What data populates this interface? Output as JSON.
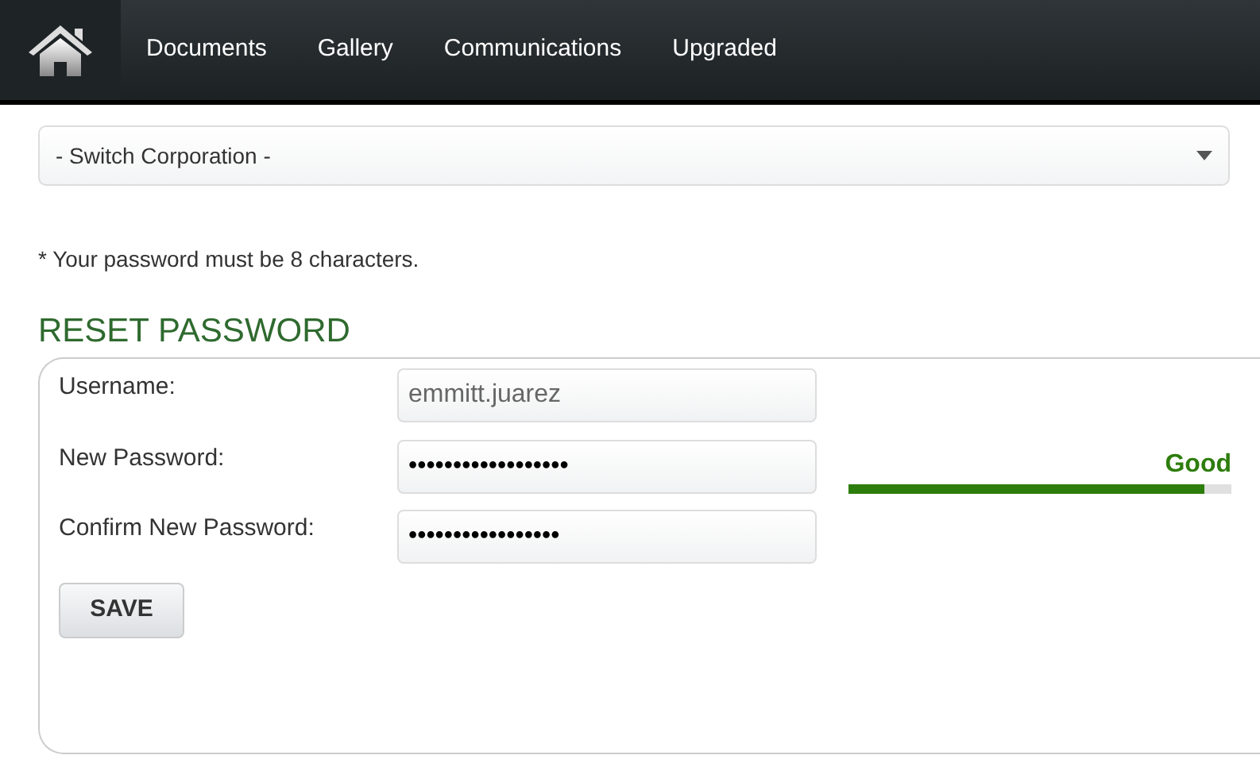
{
  "navbar": {
    "items": [
      {
        "label": "Documents"
      },
      {
        "label": "Gallery"
      },
      {
        "label": "Communications"
      },
      {
        "label": "Upgraded"
      }
    ]
  },
  "corporation_select": {
    "value": "- Switch Corporation -"
  },
  "note": "* Your password must be 8 characters.",
  "heading": "RESET PASSWORD",
  "form": {
    "fields": [
      {
        "label": "Username:",
        "value": "emmitt.juarez",
        "disabled": true
      },
      {
        "label": "New Password:",
        "value": "••••••••••••••••••",
        "disabled": false
      },
      {
        "label": "Confirm New Password:",
        "value": "•••••••••••••••••",
        "disabled": false
      }
    ],
    "strength": {
      "label": "Good",
      "level": 0.93
    },
    "button": "SAVE"
  }
}
